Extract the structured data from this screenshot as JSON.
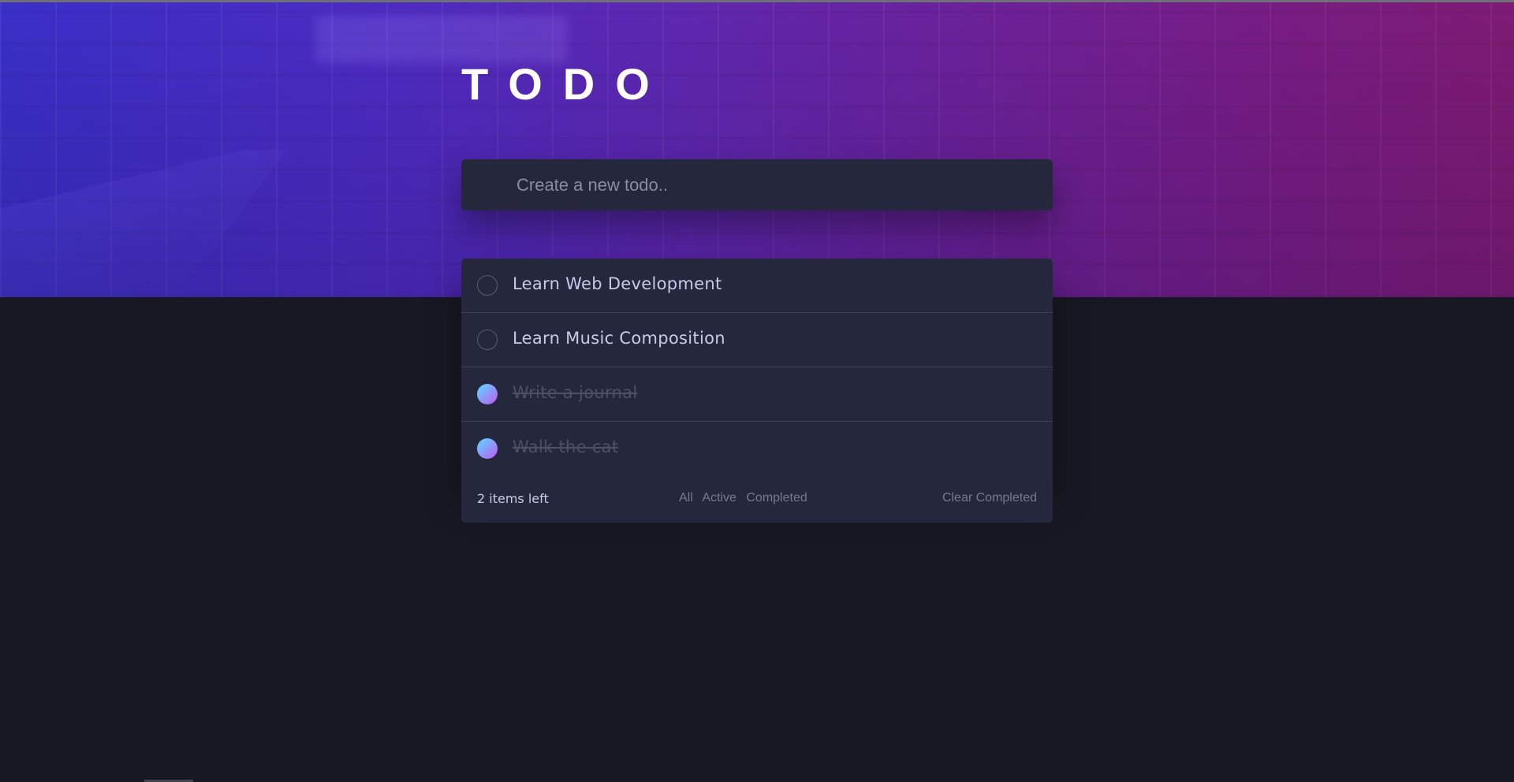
{
  "header": {
    "title": "TODO"
  },
  "new_todo": {
    "placeholder": "Create a new todo.."
  },
  "todos": [
    {
      "text": "Learn Web Development",
      "completed": false
    },
    {
      "text": "Learn Music Composition",
      "completed": false
    },
    {
      "text": "Write a journal",
      "completed": true
    },
    {
      "text": "Walk the cat",
      "completed": true
    }
  ],
  "footer": {
    "items_left": "2 items left",
    "filters": [
      "All",
      "Active",
      "Completed"
    ],
    "clear_label": "Clear Completed"
  },
  "colors": {
    "background": "#181824",
    "card": "#25273c",
    "check_gradient_start": "#57ddff",
    "check_gradient_end": "#c058f3",
    "hero_left": "#3a2fc7",
    "hero_right": "#7f1b74"
  }
}
